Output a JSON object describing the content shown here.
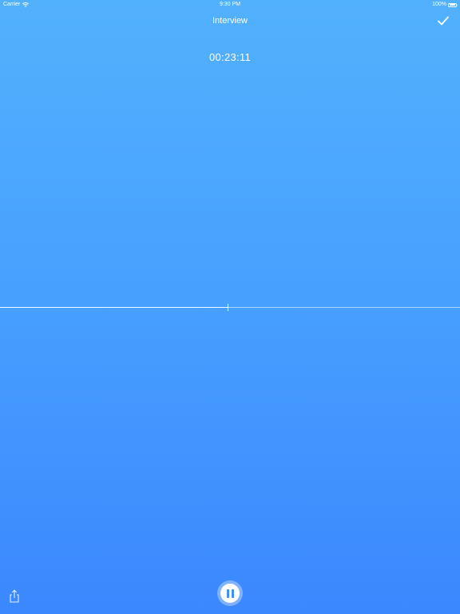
{
  "status_bar": {
    "carrier": "Carrier",
    "time": "9:30 PM",
    "battery": "100%",
    "battery_level": 1.0,
    "wifi_icon": "wifi-icon",
    "battery_icon": "battery-icon"
  },
  "nav": {
    "title": "Interview",
    "done_icon": "checkmark-icon"
  },
  "recording": {
    "elapsed": "00:23:11",
    "playhead_fraction": 0.495
  },
  "controls": {
    "share_icon": "share-icon",
    "pause_icon": "pause-icon"
  },
  "colors": {
    "background_top": "#52b1fd",
    "background_bottom": "#3b87fe",
    "foreground": "#ffffff",
    "pause_glyph": "#3f8ffe"
  }
}
